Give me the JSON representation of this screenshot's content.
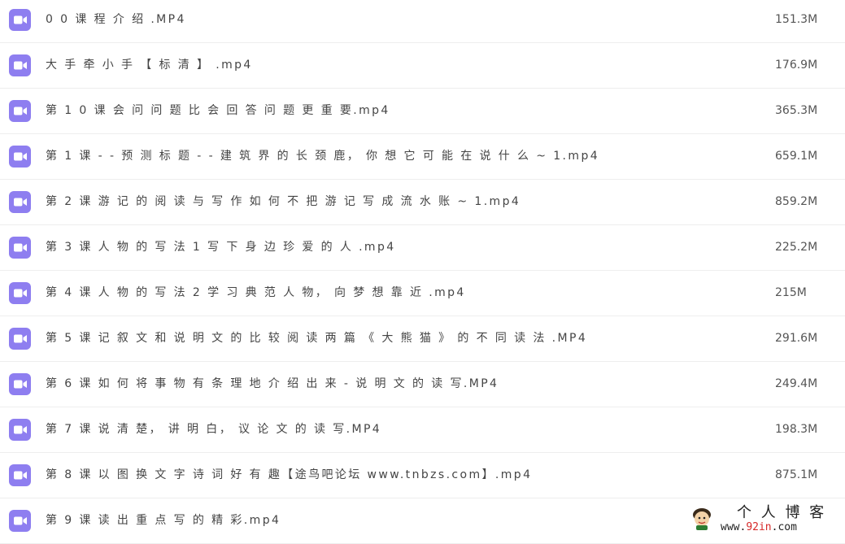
{
  "files": [
    {
      "name": "0 0 课 程 介 绍 .MP4",
      "size": "151.3M"
    },
    {
      "name": "大 手 牵 小 手 【 标 清 】 .mp4",
      "size": "176.9M"
    },
    {
      "name": "第 1 0 课 会 问 问 题 比 会 回 答 问 题 更 重 要.mp4",
      "size": "365.3M"
    },
    {
      "name": "第 1 课 - - 预 测 标 题 - - 建 筑 界 的 长 颈 鹿， 你 想 它 可 能 在 说 什 么 ~ 1.mp4",
      "size": "659.1M"
    },
    {
      "name": "第 2 课 游 记 的 阅 读 与 写 作 如 何 不 把 游 记 写 成 流 水 账 ~ 1.mp4",
      "size": "859.2M"
    },
    {
      "name": "第 3 课 人 物 的 写 法 1 写 下 身 边 珍 爱 的 人 .mp4",
      "size": "225.2M"
    },
    {
      "name": "第 4 课 人 物 的 写 法 2 学 习 典 范 人 物， 向 梦 想 靠 近 .mp4",
      "size": "215M"
    },
    {
      "name": "第 5 课 记 叙 文 和 说 明 文 的 比 较 阅 读 两 篇 《 大 熊 猫 》 的 不 同 读 法 .MP4",
      "size": "291.6M"
    },
    {
      "name": "第 6 课 如 何 将 事 物 有 条 理 地 介 绍 出 来 - 说 明 文 的 读 写.MP4",
      "size": "249.4M"
    },
    {
      "name": "第 7 课 说 清 楚， 讲 明 白， 议 论 文 的 读 写.MP4",
      "size": "198.3M"
    },
    {
      "name": "第 8 课 以 图 换 文 字 诗 词 好 有 趣【途鸟吧论坛 www.tnbzs.com】.mp4",
      "size": "875.1M"
    },
    {
      "name": "第 9 课 读 出 重 点 写 的 精 彩.mp4",
      "size": ""
    }
  ],
  "icon": {
    "name": "video-file-icon",
    "color": "#8e7ef0"
  },
  "watermark": {
    "title": "个 人 博 客",
    "url_prefix": "www.",
    "url_accent": "92in",
    "url_suffix": ".com"
  }
}
